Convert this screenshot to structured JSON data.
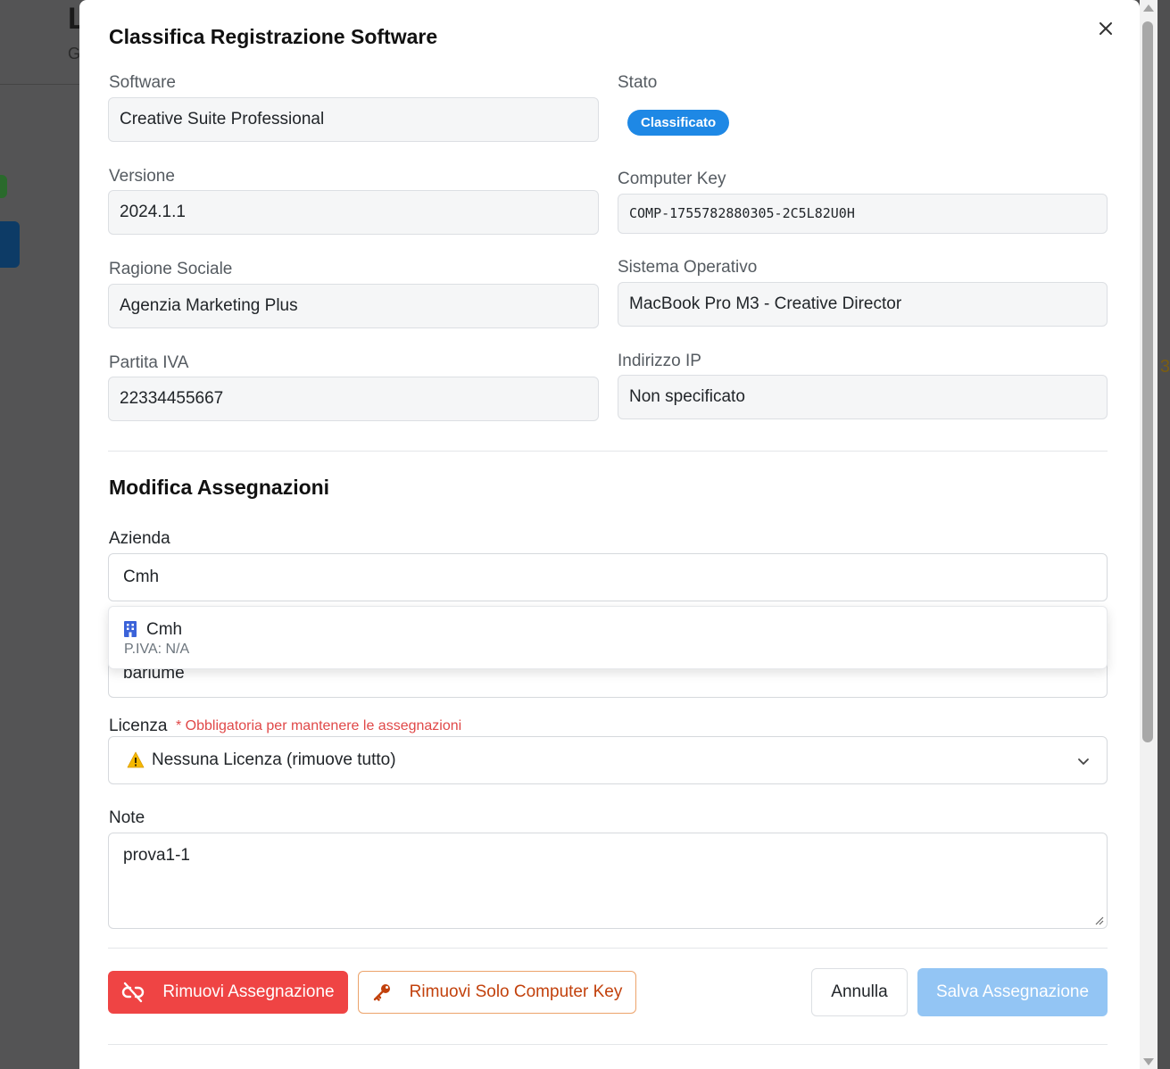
{
  "modal": {
    "title": "Classifica Registrazione Software",
    "close_icon": "close-icon"
  },
  "info": {
    "software_label": "Software",
    "software_value": "Creative Suite Professional",
    "stato_label": "Stato",
    "stato_value": "Classificato",
    "versione_label": "Versione",
    "versione_value": "2024.1.1",
    "computer_key_label": "Computer Key",
    "computer_key_value": "COMP-1755782880305-2C5L82U0H",
    "ragione_label": "Ragione Sociale",
    "ragione_value": "Agenzia Marketing Plus",
    "sistema_label": "Sistema Operativo",
    "sistema_value": "MacBook Pro M3 - Creative Director",
    "piva_label": "Partita IVA",
    "piva_value": "22334455667",
    "ip_label": "Indirizzo IP",
    "ip_value": "Non specificato"
  },
  "assign": {
    "section_title": "Modifica Assegnazioni",
    "azienda_label": "Azienda",
    "azienda_value": "Cmh",
    "hidden_field_value": "bariume",
    "suggestion": {
      "name": "Cmh",
      "sub": "P.IVA: N/A",
      "icon": "building-icon"
    },
    "licenza_label": "Licenza",
    "licenza_required": "* Obbligatoria per mantenere le assegnazioni",
    "licenza_value": "Nessuna Licenza (rimuove tutto)",
    "licenza_icon": "warning-icon",
    "note_label": "Note",
    "note_value": "prova1-1"
  },
  "actions": {
    "remove_assignment": "Rimuovi Assegnazione",
    "remove_key": "Rimuovi Solo Computer Key",
    "cancel": "Annulla",
    "save": "Salva Assegnazione"
  },
  "background": {
    "title_fragment": "L",
    "sub_fragment": "G",
    "right_fragment": "3"
  },
  "colors": {
    "badge": "#1e88e5",
    "danger": "#ef4444",
    "warning_text": "#c2410c",
    "save_disabled": "#93c5f4",
    "required": "#e04848"
  }
}
